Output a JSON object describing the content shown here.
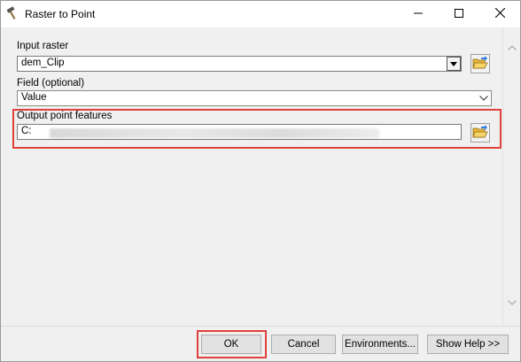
{
  "window": {
    "title": "Raster to Point",
    "controls": {
      "minimize": "minimize",
      "maximize": "maximize",
      "close": "close"
    }
  },
  "form": {
    "input_raster": {
      "label": "Input raster",
      "value": "dem_Clip"
    },
    "field": {
      "label": "Field (optional)",
      "value": "Value"
    },
    "output": {
      "label": "Output point features",
      "value": "C:"
    }
  },
  "buttons": {
    "ok": "OK",
    "cancel": "Cancel",
    "environments": "Environments...",
    "show_help": "Show Help >>"
  },
  "colors": {
    "highlight": "#e0413b",
    "window_bg": "#f0f0f0",
    "titlebar_bg": "#ffffff"
  },
  "icons": {
    "title": "hammer-icon",
    "browse": "open-folder-icon"
  }
}
